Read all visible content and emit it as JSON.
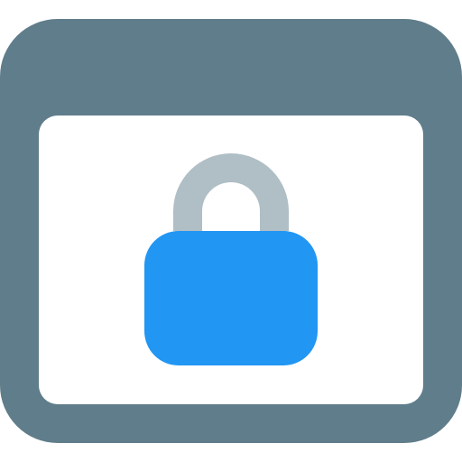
{
  "icon": {
    "name": "browser-lock-icon",
    "parts": {
      "window": "browser-window-icon",
      "lock": "padlock-icon"
    }
  },
  "colors": {
    "window_frame": "#607d8b",
    "window_content": "#ffffff",
    "lock_shackle": "#b0bec5",
    "lock_body": "#2196f3",
    "background": "#ffffff"
  }
}
